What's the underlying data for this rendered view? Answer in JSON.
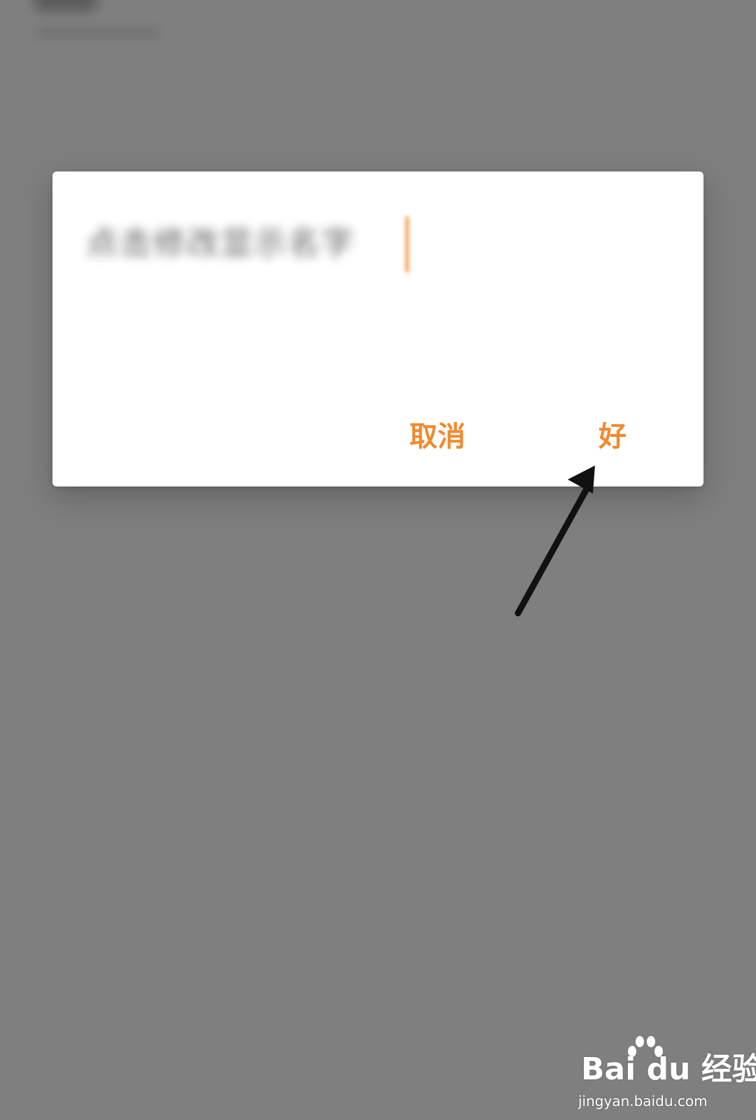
{
  "dialog": {
    "input_value": "点击修改显示名字",
    "cancel_label": "取消",
    "confirm_label": "好"
  },
  "watermark": {
    "brand": "Bai du 经验",
    "url": "jingyan.baidu.com"
  },
  "colors": {
    "overlay": "#7f7f7f",
    "dialog_background": "#ffffff",
    "accent": "#f08a2f",
    "annotation_arrow": "#111111"
  }
}
